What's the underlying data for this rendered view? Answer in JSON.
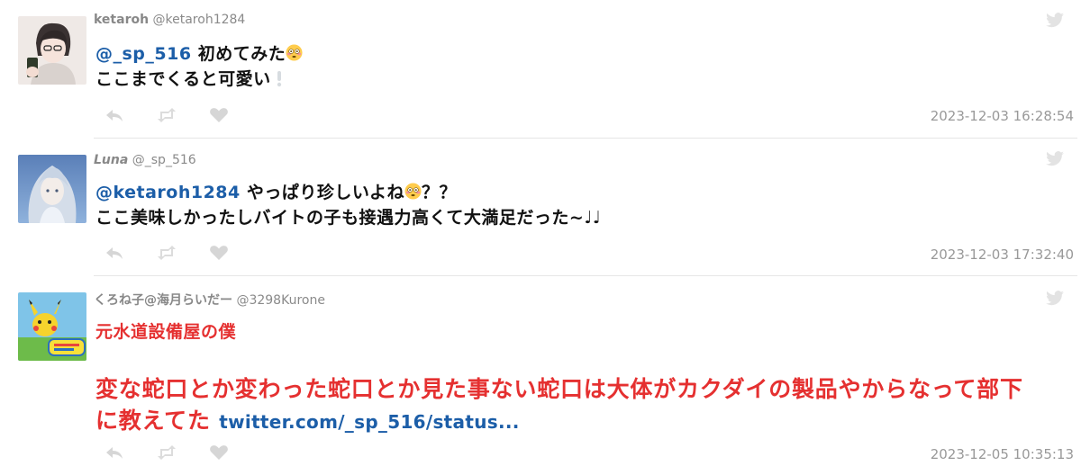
{
  "tweets": [
    {
      "name": "ketaroh",
      "handle": "@ketaroh1284",
      "mention": "@_sp_516",
      "line1_rest": " 初めてみた",
      "line2": "ここまでくると可愛い",
      "timestamp": "2023-12-03 16:28:54"
    },
    {
      "name": "Luna",
      "handle": "@_sp_516",
      "mention": "@ketaroh1284",
      "line1_rest": " やっぱり珍しいよね",
      "line1_tail": "？？",
      "line2": "ここ美味しかったしバイトの子も接遇力高くて大満足だった~♩♩",
      "timestamp": "2023-12-03 17:32:40"
    },
    {
      "name": "くろね子@海月らいだー",
      "handle": "@3298Kurone",
      "line1": "元水道設備屋の僕",
      "big_line1": "変な蛇口とか変わった蛇口とか見た事ない蛇口は大体がカクダイの製品やからなって部下",
      "big_line2": "に教えてた",
      "link": "twitter.com/_sp_516/status...",
      "timestamp": "2023-12-05 10:35:13"
    }
  ],
  "icons": {
    "bird": "twitter-bird-icon",
    "reply": "reply-icon",
    "retweet": "retweet-icon",
    "like": "heart-icon",
    "emoji": "flushed-face-emoji-icon",
    "exclaim": "white-exclamation-icon"
  },
  "colors": {
    "mention": "#1c5ea8",
    "red_text": "#e53030",
    "meta": "#999999",
    "divider": "#e6e6e6"
  }
}
